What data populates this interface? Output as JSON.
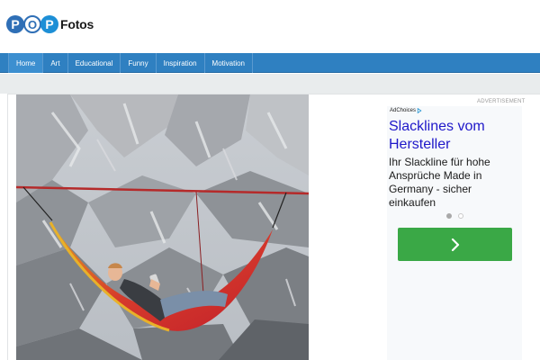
{
  "site": {
    "logo_letter_1": "P",
    "logo_letter_2": "O",
    "logo_letter_3": "P",
    "logo_text": "Fotos"
  },
  "nav": {
    "items": [
      {
        "label": "Home"
      },
      {
        "label": "Art"
      },
      {
        "label": "Educational"
      },
      {
        "label": "Funny"
      },
      {
        "label": "Inspiration"
      },
      {
        "label": "Motivation"
      }
    ]
  },
  "ad": {
    "label": "ADVERTISEMENT",
    "adchoices": "AdChoices",
    "headline": "Slacklines vom Hersteller",
    "body": "Ihr Slackline für hohe Ansprüche Made in Germany - sicher einkaufen",
    "cta_icon": "chevron-right-icon",
    "dots_active_index": 0
  },
  "colors": {
    "brand_blue": "#2f6fb6",
    "nav_blue": "#2f80c1",
    "ad_headline": "#1f18c9",
    "cta_green": "#3aa846"
  }
}
